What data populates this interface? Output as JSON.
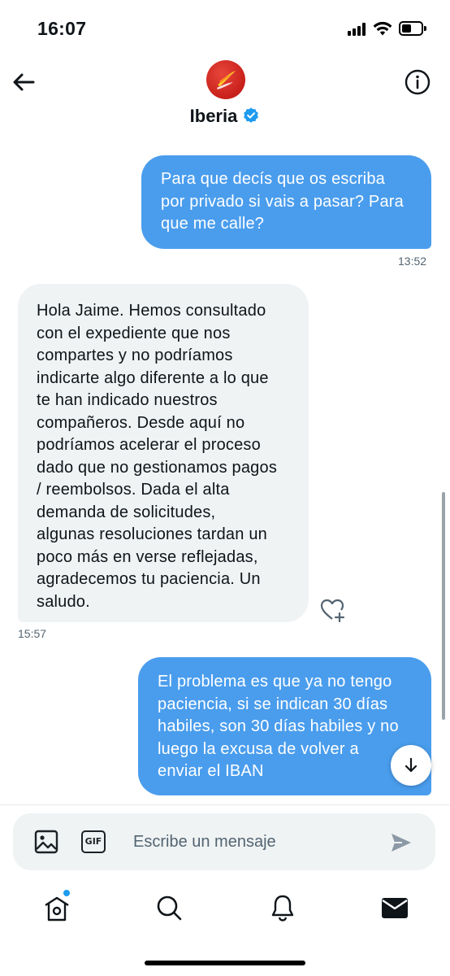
{
  "status_bar": {
    "time": "16:07",
    "icons": [
      "signal-icon",
      "wifi-icon",
      "battery-icon"
    ]
  },
  "header": {
    "name": "Iberia",
    "verified": true,
    "icons": [
      "back-arrow-icon",
      "iberia-logo",
      "verified-badge-icon",
      "info-icon"
    ]
  },
  "messages": [
    {
      "direction": "outgoing",
      "lines": [
        "Para que decís que os escriba",
        "por privado si vais a pasar? Para",
        "que me calle?"
      ],
      "time": "13:52"
    },
    {
      "direction": "incoming",
      "lines": [
        "Hola Jaime. Hemos consultado",
        "con el expediente que nos",
        "compartes y no podríamos",
        "indicarte algo diferente a lo que",
        "te han indicado nuestros",
        "compañeros. Desde aquí no",
        "podríamos acelerar el proceso",
        "dado que no gestionamos pagos",
        "/ reembolsos. Dada el alta",
        "demanda de solicitudes,",
        "algunas resoluciones tardan un",
        "poco más en verse reflejadas,",
        "agradecemos tu paciencia. Un",
        "saludo."
      ],
      "time": "15:57"
    },
    {
      "direction": "outgoing",
      "lines": [
        "El problema es que ya no tengo",
        "paciencia, si se indican 30 días",
        "habiles, son 30 días habiles y no",
        "luego la excusa de volver a",
        "enviar el IBAN"
      ]
    }
  ],
  "compose": {
    "placeholder": "Escribe un mensaje",
    "value": "",
    "gif_label": "GIF"
  },
  "colors": {
    "accent": "#1d9bf0",
    "outgoing_bubble": "#4a9ded",
    "incoming_bubble": "#eff3f4",
    "timestamp": "#536471",
    "brand_red": "#d42a23"
  },
  "tab_bar": {
    "tabs": [
      "home-icon",
      "search-icon",
      "bell-icon",
      "mail-icon"
    ],
    "active": "mail-icon",
    "home_has_notification_dot": true
  }
}
